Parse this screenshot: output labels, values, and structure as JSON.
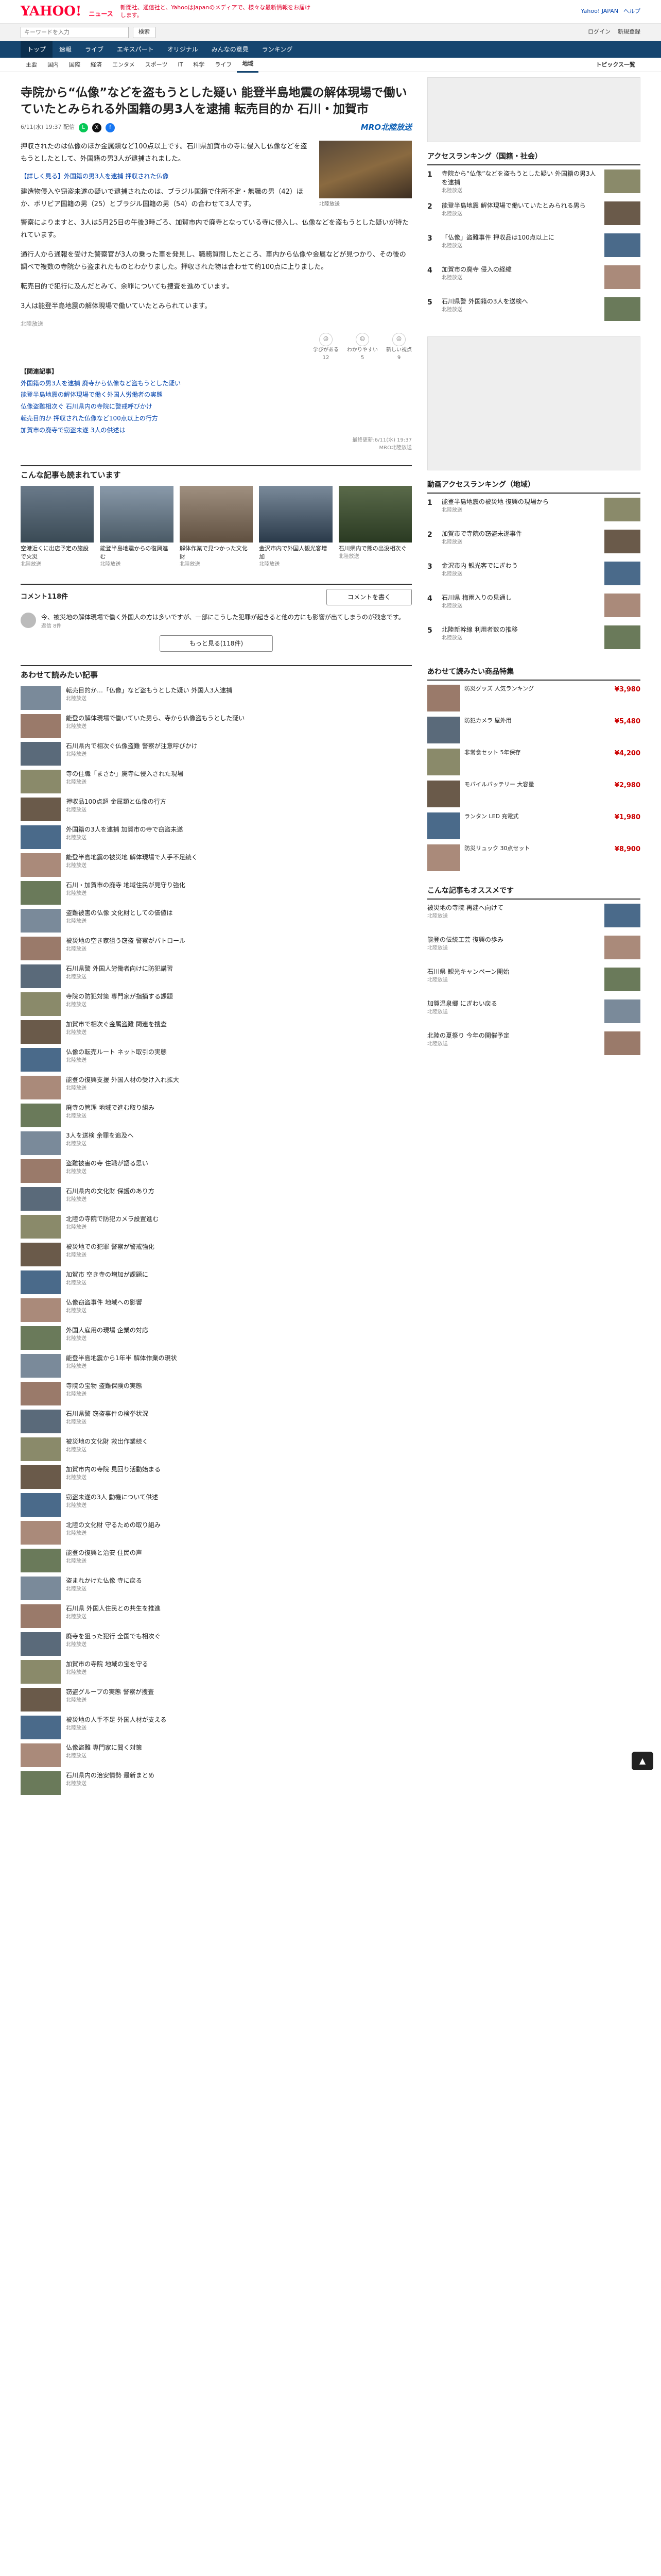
{
  "header": {
    "logo": "YAHOO!",
    "logo_sub": "ニュース",
    "promo": "新聞社、通信社と、YahooはJapanのメディアで、様々な最新情報をお届けします。",
    "links": [
      "Yahoo! JAPAN",
      "ヘルプ"
    ]
  },
  "search": {
    "placeholder": "キーワードを入力",
    "button": "検索",
    "login": "ログイン",
    "register": "新規登録"
  },
  "nav_primary": [
    "トップ",
    "速報",
    "ライブ",
    "エキスパート",
    "オリジナル",
    "みんなの意見",
    "ランキング"
  ],
  "nav_secondary": [
    "主要",
    "国内",
    "国際",
    "経済",
    "エンタメ",
    "スポーツ",
    "IT",
    "科学",
    "ライフ",
    "地域"
  ],
  "nav_secondary_right": "トピックス一覧",
  "article": {
    "title": "寺院から“仏像”などを盗もうとした疑い 能登半島地震の解体現場で働いていたとみられる外国籍の男3人を逮捕 転売目的か 石川・加賀市",
    "date": "6/11(水) 19:37 配信",
    "source_logo": "MRO北陸放送",
    "lead": [
      "押収されたのは仏像のほか金属類など100点以上です。石川県加賀市の寺に侵入し仏像などを盗もうとしたとして、外国籍の男3人が逮捕されました。"
    ],
    "link": "【詳しく見る】外国籍の男3人を逮捕 押収された仏像",
    "paragraphs": [
      "建造物侵入や窃盗未遂の疑いで逮捕されたのは、ブラジル国籍で住所不定・無職の男（42）ほか、ボリビア国籍の男（25）とブラジル国籍の男（54）の合わせて3人です。",
      "警察によりますと、3人は5月25日の午後3時ごろ、加賀市内で廃寺となっている寺に侵入し、仏像などを盗もうとした疑いが持たれています。",
      "通行人から通報を受けた警察官が3人の乗った車を発見し、職務質問したところ、車内から仏像や金属などが見つかり、その後の調べで複数の寺院から盗まれたものとわかりました。押収された物は合わせて約100点に上りました。",
      "転売目的で犯行に及んだとみて、余罪についても捜査を進めています。",
      "3人は能登半島地震の解体現場で働いていたとみられています。"
    ],
    "photo_caption": "北陸放送",
    "source_note": "北陸放送",
    "reactions": [
      {
        "label": "学びがある",
        "count": "12"
      },
      {
        "label": "わかりやすい",
        "count": "5"
      },
      {
        "label": "新しい視点",
        "count": "9"
      }
    ],
    "related_title": "【関連記事】",
    "related": [
      "外国籍の男3人を逮捕 廃寺から仏像など盗もうとした疑い",
      "能登半島地震の解体現場で働く外国人労働者の実態",
      "仏像盗難相次ぐ 石川県内の寺院に警戒呼びかけ",
      "転売目的か 押収された仏像など100点以上の行方",
      "加賀市の廃寺で窃盗未遂 3人の供述は"
    ],
    "footer_date": "最終更新:6/11(水) 19:37",
    "footer_src": "MRO北陸放送"
  },
  "recommend": {
    "title": "こんな記事も読まれています",
    "cards": [
      {
        "title": "空港近くに出店予定の施設で火災",
        "meta": "北陸放送"
      },
      {
        "title": "能登半島地震からの復興進む",
        "meta": "北陸放送"
      },
      {
        "title": "解体作業で見つかった文化財",
        "meta": "北陸放送"
      },
      {
        "title": "金沢市内で外国人観光客増加",
        "meta": "北陸放送"
      },
      {
        "title": "石川県内で熊の出没相次ぐ",
        "meta": "北陸放送"
      }
    ]
  },
  "comments": {
    "title": "コメント118件",
    "button": "コメントを書く",
    "sample": "今、被災地の解体現場で働く外国人の方は多いですが、一部にこうした犯罪が起きると他の方にも影響が出てしまうのが残念です。",
    "sample_meta": "返信 8件",
    "more": "もっと見る(118件)"
  },
  "more_list": {
    "title": "あわせて読みたい記事",
    "items": [
      {
        "title": "転売目的か…「仏像」など盗もうとした疑い 外国人3人逮捕",
        "meta": "北陸放送"
      },
      {
        "title": "能登の解体現場で働いていた男ら、寺から仏像盗もうとした疑い",
        "meta": "北陸放送"
      },
      {
        "title": "石川県内で相次ぐ仏像盗難 警察が注意呼びかけ",
        "meta": "北陸放送"
      },
      {
        "title": "寺の住職「まさか」廃寺に侵入された現場",
        "meta": "北陸放送"
      },
      {
        "title": "押収品100点超 金属類と仏像の行方",
        "meta": "北陸放送"
      },
      {
        "title": "外国籍の3人を逮捕 加賀市の寺で窃盗未遂",
        "meta": "北陸放送"
      },
      {
        "title": "能登半島地震の被災地 解体現場で人手不足続く",
        "meta": "北陸放送"
      },
      {
        "title": "石川・加賀市の廃寺 地域住民が見守り強化",
        "meta": "北陸放送"
      },
      {
        "title": "盗難被害の仏像 文化財としての価値は",
        "meta": "北陸放送"
      },
      {
        "title": "被災地の空き家狙う窃盗 警察がパトロール",
        "meta": "北陸放送"
      },
      {
        "title": "石川県警 外国人労働者向けに防犯講習",
        "meta": "北陸放送"
      },
      {
        "title": "寺院の防犯対策 専門家が指摘する課題",
        "meta": "北陸放送"
      },
      {
        "title": "加賀市で相次ぐ金属盗難 関連を捜査",
        "meta": "北陸放送"
      },
      {
        "title": "仏像の転売ルート ネット取引の実態",
        "meta": "北陸放送"
      },
      {
        "title": "能登の復興支援 外国人材の受け入れ拡大",
        "meta": "北陸放送"
      },
      {
        "title": "廃寺の管理 地域で進む取り組み",
        "meta": "北陸放送"
      },
      {
        "title": "3人を送検 余罪を追及へ",
        "meta": "北陸放送"
      },
      {
        "title": "盗難被害の寺 住職が語る思い",
        "meta": "北陸放送"
      },
      {
        "title": "石川県内の文化財 保護のあり方",
        "meta": "北陸放送"
      },
      {
        "title": "北陸の寺院で防犯カメラ設置進む",
        "meta": "北陸放送"
      },
      {
        "title": "被災地での犯罪 警察が警戒強化",
        "meta": "北陸放送"
      },
      {
        "title": "加賀市 空き寺の増加が課題に",
        "meta": "北陸放送"
      },
      {
        "title": "仏像窃盗事件 地域への影響",
        "meta": "北陸放送"
      },
      {
        "title": "外国人雇用の現場 企業の対応",
        "meta": "北陸放送"
      },
      {
        "title": "能登半島地震から1年半 解体作業の現状",
        "meta": "北陸放送"
      },
      {
        "title": "寺院の宝物 盗難保険の実態",
        "meta": "北陸放送"
      },
      {
        "title": "石川県警 窃盗事件の検挙状況",
        "meta": "北陸放送"
      },
      {
        "title": "被災地の文化財 救出作業続く",
        "meta": "北陸放送"
      },
      {
        "title": "加賀市内の寺院 見回り活動始まる",
        "meta": "北陸放送"
      },
      {
        "title": "窃盗未遂の3人 動機について供述",
        "meta": "北陸放送"
      },
      {
        "title": "北陸の文化財 守るための取り組み",
        "meta": "北陸放送"
      },
      {
        "title": "能登の復興と治安 住民の声",
        "meta": "北陸放送"
      },
      {
        "title": "盗まれかけた仏像 寺に戻る",
        "meta": "北陸放送"
      },
      {
        "title": "石川県 外国人住民との共生を推進",
        "meta": "北陸放送"
      },
      {
        "title": "廃寺を狙った犯行 全国でも相次ぐ",
        "meta": "北陸放送"
      },
      {
        "title": "加賀市の寺院 地域の宝を守る",
        "meta": "北陸放送"
      },
      {
        "title": "窃盗グループの実態 警察が捜査",
        "meta": "北陸放送"
      },
      {
        "title": "被災地の人手不足 外国人材が支える",
        "meta": "北陸放送"
      },
      {
        "title": "仏像盗難 専門家に聞く対策",
        "meta": "北陸放送"
      },
      {
        "title": "石川県内の治安情勢 最新まとめ",
        "meta": "北陸放送"
      }
    ]
  },
  "sidebar": {
    "access_title": "アクセスランキング（国籍・社会）",
    "access": [
      {
        "rank": "1",
        "title": "寺院から“仏像”などを盗もうとした疑い 外国籍の男3人を逮捕",
        "meta": "北陸放送"
      },
      {
        "rank": "2",
        "title": "能登半島地震 解体現場で働いていたとみられる男ら",
        "meta": "北陸放送"
      },
      {
        "rank": "3",
        "title": "「仏像」盗難事件 押収品は100点以上に",
        "meta": "北陸放送"
      },
      {
        "rank": "4",
        "title": "加賀市の廃寺 侵入の経緯",
        "meta": "北陸放送"
      },
      {
        "rank": "5",
        "title": "石川県警 外国籍の3人を送検へ",
        "meta": "北陸放送"
      }
    ],
    "local_title": "動画アクセスランキング（地域）",
    "local": [
      {
        "rank": "1",
        "title": "能登半島地震の被災地 復興の現場から",
        "meta": "北陸放送"
      },
      {
        "rank": "2",
        "title": "加賀市で寺院の窃盗未遂事件",
        "meta": "北陸放送"
      },
      {
        "rank": "3",
        "title": "金沢市内 観光客でにぎわう",
        "meta": "北陸放送"
      },
      {
        "rank": "4",
        "title": "石川県 梅雨入りの見通し",
        "meta": "北陸放送"
      },
      {
        "rank": "5",
        "title": "北陸新幹線 利用者数の推移",
        "meta": "北陸放送"
      }
    ],
    "shop_title": "あわせて読みたい商品特集",
    "shop": [
      {
        "title": "防災グッズ 人気ランキング",
        "price": "¥3,980"
      },
      {
        "title": "防犯カメラ 屋外用",
        "price": "¥5,480"
      },
      {
        "title": "非常食セット 5年保存",
        "price": "¥4,200"
      },
      {
        "title": "モバイルバッテリー 大容量",
        "price": "¥2,980"
      },
      {
        "title": "ランタン LED 充電式",
        "price": "¥1,980"
      },
      {
        "title": "防災リュック 30点セット",
        "price": "¥8,900"
      }
    ],
    "topic_title": "こんな記事もオススメです",
    "topic": [
      {
        "title": "被災地の寺院 再建へ向けて",
        "meta": "北陸放送"
      },
      {
        "title": "能登の伝統工芸 復興の歩み",
        "meta": "北陸放送"
      },
      {
        "title": "石川県 観光キャンペーン開始",
        "meta": "北陸放送"
      },
      {
        "title": "加賀温泉郷 にぎわい戻る",
        "meta": "北陸放送"
      },
      {
        "title": "北陸の夏祭り 今年の開催予定",
        "meta": "北陸放送"
      }
    ]
  }
}
